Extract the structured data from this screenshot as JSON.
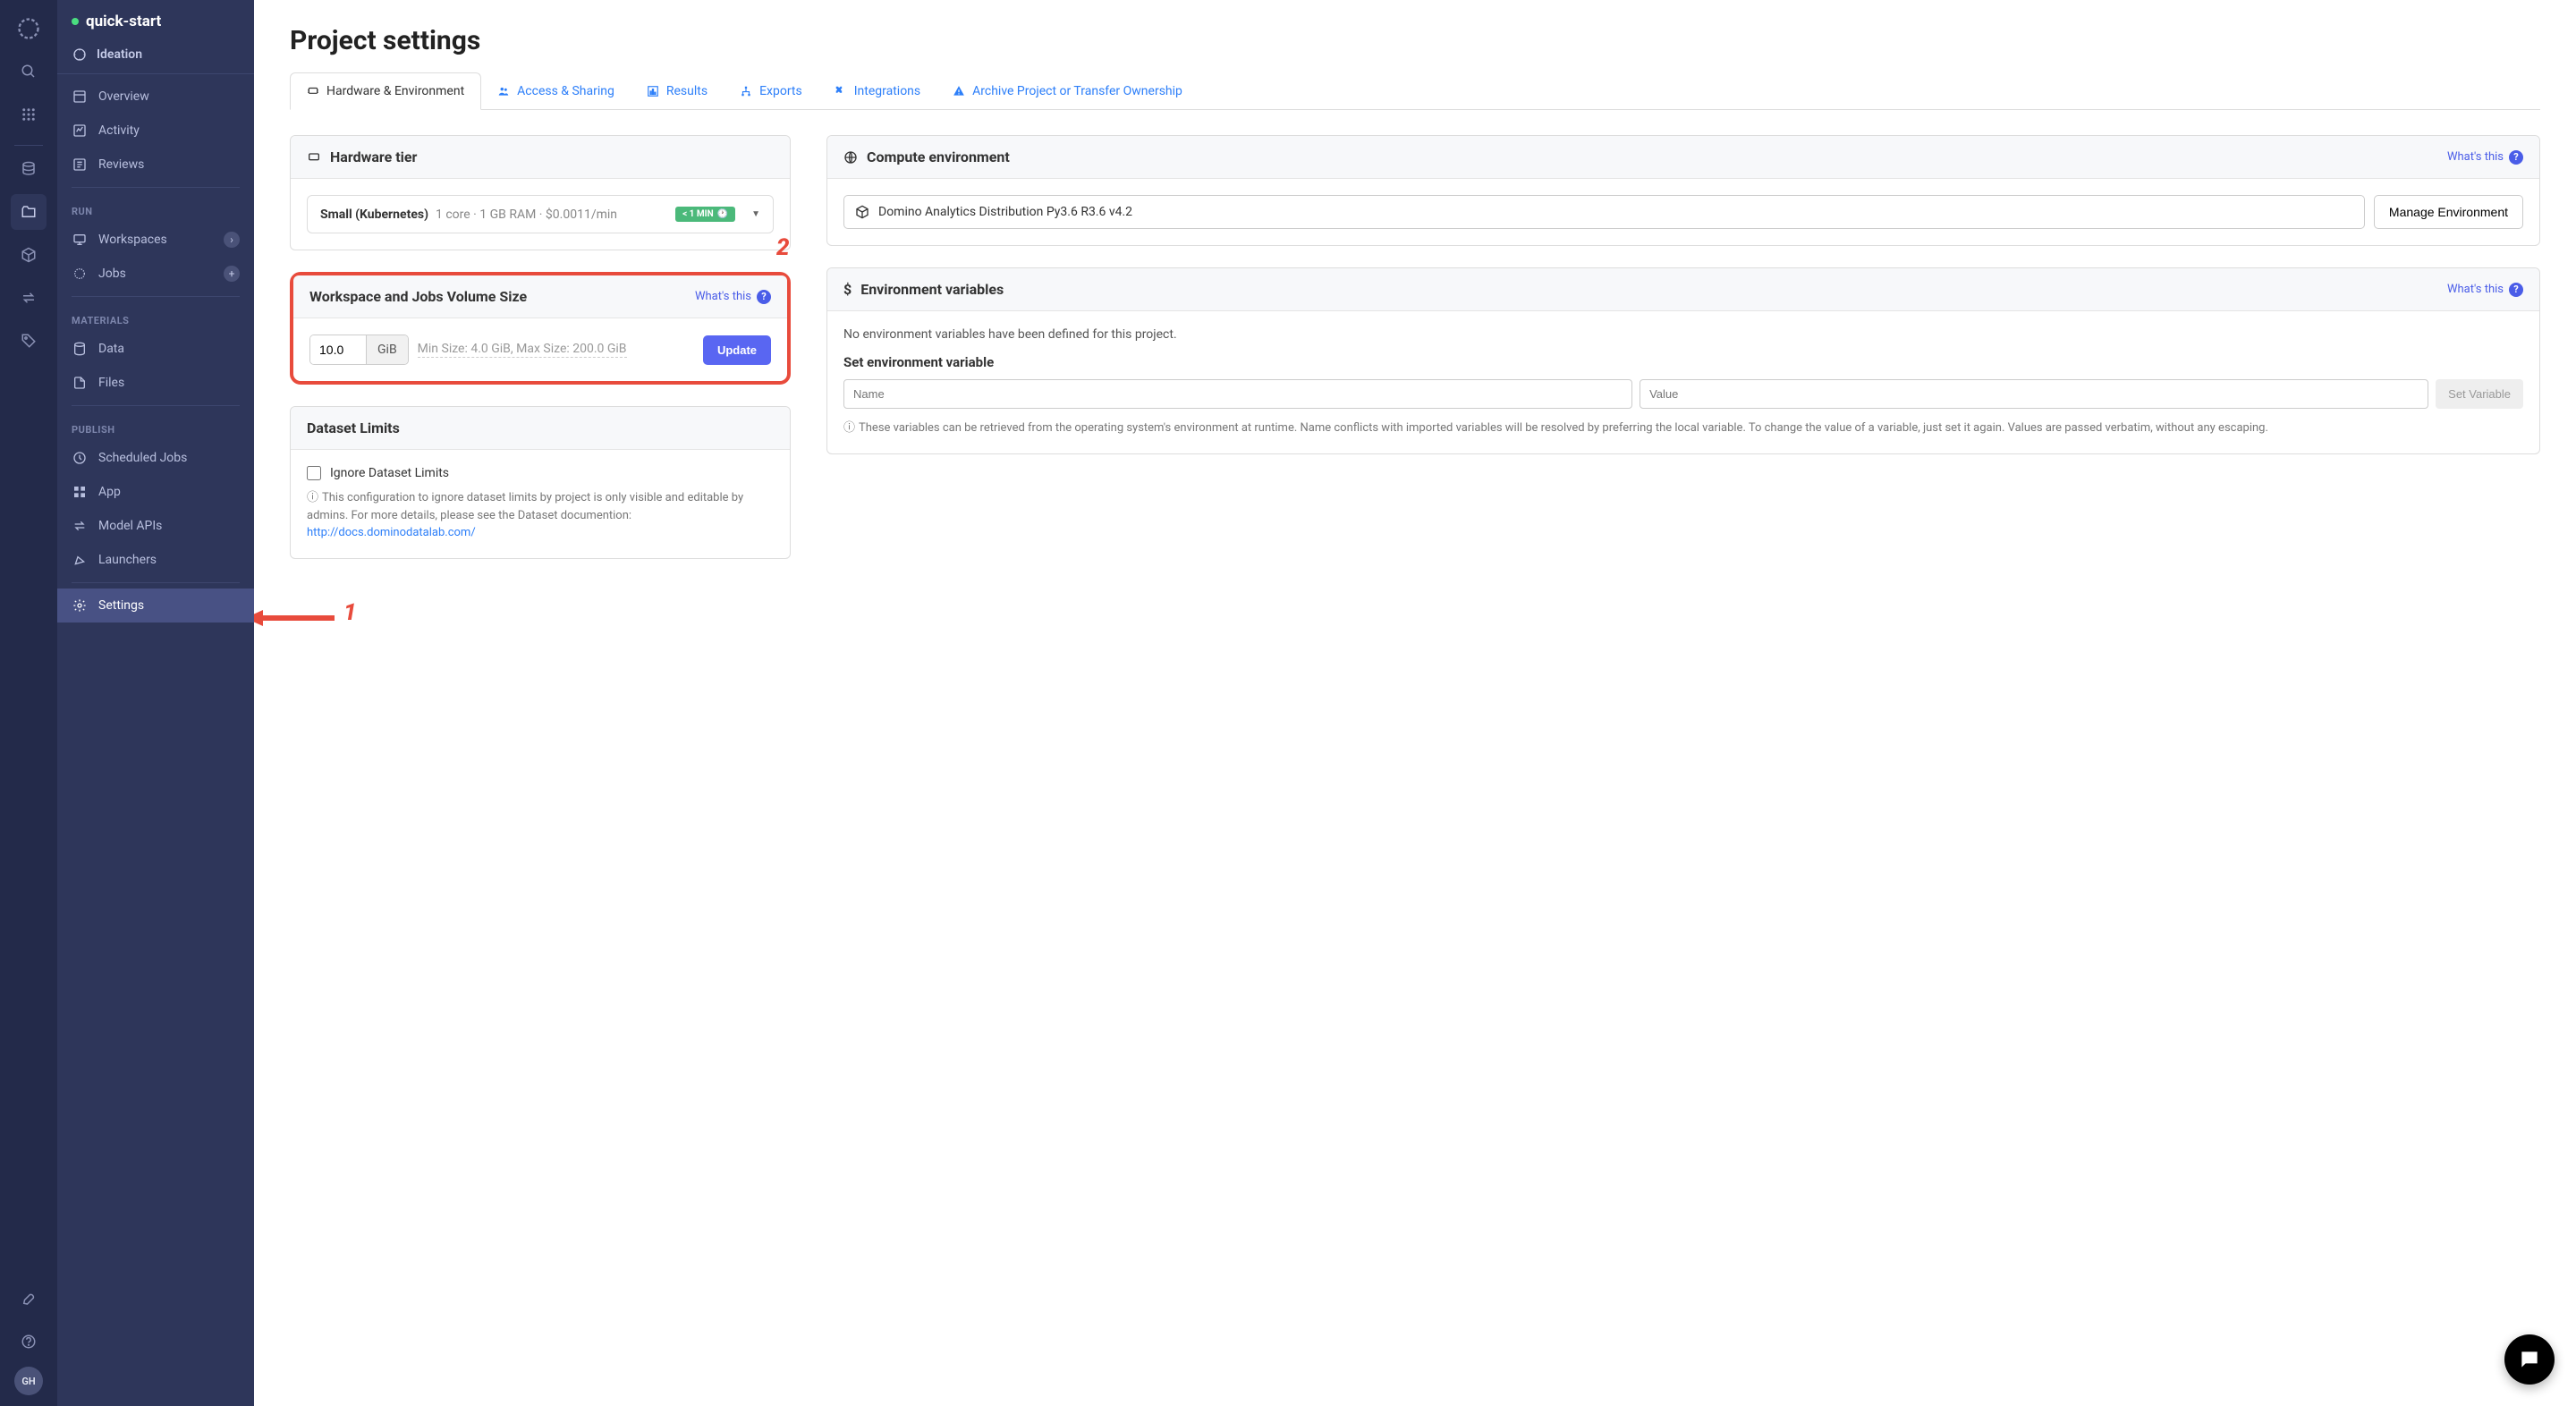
{
  "project": {
    "name": "quick-start",
    "ideation_label": "Ideation"
  },
  "rail": {
    "avatar": "GH"
  },
  "sidebar": {
    "overview": "Overview",
    "activity": "Activity",
    "reviews": "Reviews",
    "section_run": "RUN",
    "workspaces": "Workspaces",
    "jobs": "Jobs",
    "section_materials": "MATERIALS",
    "data": "Data",
    "files": "Files",
    "section_publish": "PUBLISH",
    "scheduled_jobs": "Scheduled Jobs",
    "app": "App",
    "model_apis": "Model APIs",
    "launchers": "Launchers",
    "settings": "Settings"
  },
  "page": {
    "title": "Project settings"
  },
  "tabs": {
    "hardware": "Hardware & Environment",
    "access": "Access & Sharing",
    "results": "Results",
    "exports": "Exports",
    "integrations": "Integrations",
    "archive": "Archive Project or Transfer Ownership"
  },
  "hardware": {
    "panel_title": "Hardware tier",
    "tier_name": "Small (Kubernetes)",
    "tier_spec": "1 core · 1 GB RAM · $0.0011/min",
    "badge": "< 1 MIN"
  },
  "volume": {
    "panel_title": "Workspace and Jobs Volume Size",
    "whats_this": "What's this",
    "value": "10.0",
    "unit": "GiB",
    "hint": "Min Size: 4.0 GiB, Max Size: 200.0 GiB",
    "update": "Update"
  },
  "dataset": {
    "panel_title": "Dataset Limits",
    "checkbox_label": "Ignore Dataset Limits",
    "info": "This configuration to ignore dataset limits by project is only visible and editable by admins. For more details, please see the Dataset documention:",
    "link": "http://docs.dominodatalab.com/"
  },
  "compute": {
    "panel_title": "Compute environment",
    "whats_this": "What's this",
    "env_name": "Domino Analytics Distribution Py3.6 R3.6 v4.2",
    "manage": "Manage Environment"
  },
  "envvars": {
    "panel_title": "Environment variables",
    "whats_this": "What's this",
    "empty": "No environment variables have been defined for this project.",
    "subsection": "Set environment variable",
    "name_placeholder": "Name",
    "value_placeholder": "Value",
    "set_button": "Set Variable",
    "info": "These variables can be retrieved from the operating system's environment at runtime. Name conflicts with imported variables will be resolved by preferring the local variable. To change the value of a variable, just set it again. Values are passed verbatim, without any escaping."
  },
  "annotations": {
    "num1": "1",
    "num2": "2"
  }
}
